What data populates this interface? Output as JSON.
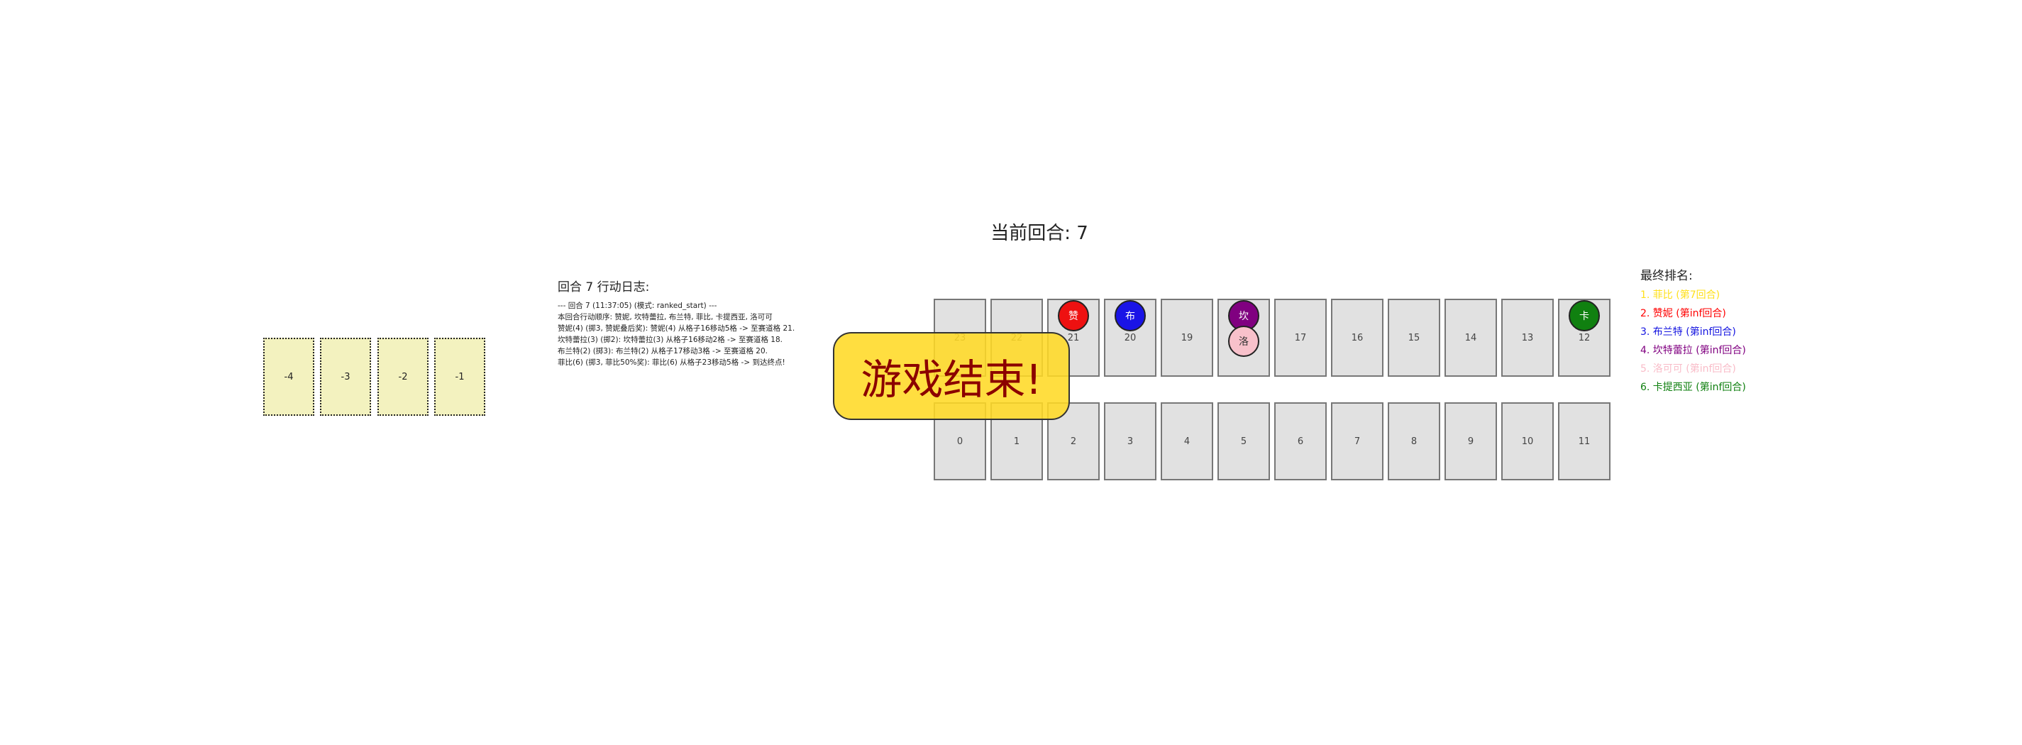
{
  "round_title": "当前回合: 7",
  "pre_cells": [
    "-4",
    "-3",
    "-2",
    "-1"
  ],
  "log": {
    "title": "回合 7 行动日志:",
    "lines": [
      "--- 回合 7 (11:37:05) (模式: ranked_start) ---",
      "本回合行动顺序: 赞妮, 坎特蕾拉, 布兰特, 菲比, 卡提西亚, 洛可可",
      "赞妮(4) (掷3, 赞妮叠后奖): 赞妮(4) 从格子16移动5格 -> 至赛道格 21.",
      "坎特蕾拉(3) (掷2): 坎特蕾拉(3) 从格子16移动2格 -> 至赛道格 18.",
      "布兰特(2) (掷3): 布兰特(2) 从格子17移动3格 -> 至赛道格 20.",
      "菲比(6) (掷3, 菲比50%奖): 菲比(6) 从格子23移动5格 -> 到达终点!"
    ]
  },
  "track_top": [
    "23",
    "22",
    "21",
    "20",
    "19",
    "18",
    "17",
    "16",
    "15",
    "14",
    "13",
    "12"
  ],
  "track_bottom": [
    "0",
    "1",
    "2",
    "3",
    "4",
    "5",
    "6",
    "7",
    "8",
    "9",
    "10",
    "11"
  ],
  "tokens": {
    "zanni": {
      "label": "赞",
      "color": "#ee1111"
    },
    "bulante": {
      "label": "布",
      "color": "#1a14e6"
    },
    "kante": {
      "label": "坎",
      "color": "#800080"
    },
    "luoke": {
      "label": "洛",
      "color": "#f8c1cb"
    },
    "katixiya": {
      "label": "卡",
      "color": "#108010"
    }
  },
  "game_over": "游戏结束!",
  "ranking": {
    "title": "最终排名:",
    "items": [
      {
        "text": "1. 菲比 (第7回合)",
        "color": "#ffe01a"
      },
      {
        "text": "2. 赞妮 (第inf回合)",
        "color": "#ff0000"
      },
      {
        "text": "3. 布兰特 (第inf回合)",
        "color": "#1414e0"
      },
      {
        "text": "4. 坎特蕾拉 (第inf回合)",
        "color": "#800080"
      },
      {
        "text": "5. 洛可可 (第inf回合)",
        "color": "#f9bcc8"
      },
      {
        "text": "6. 卡提西亚 (第inf回合)",
        "color": "#108010"
      }
    ]
  }
}
